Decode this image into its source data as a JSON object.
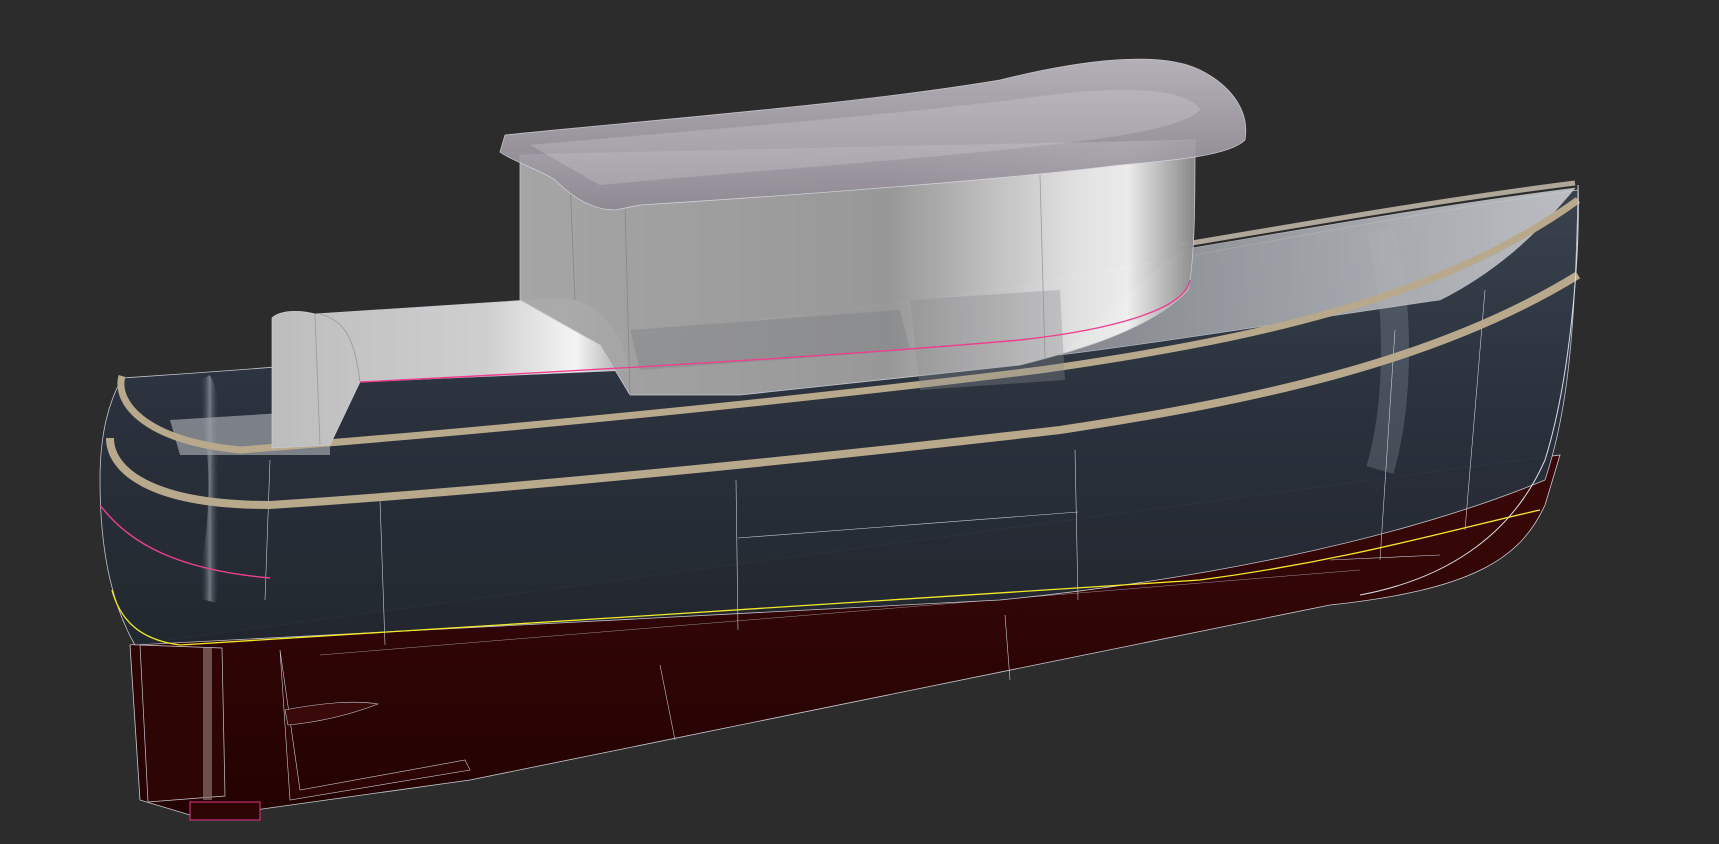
{
  "scene": {
    "subject": "tugboat-hull-3d-model",
    "background_color": "#2c2c2c",
    "colors": {
      "underbody": "#2a0404",
      "topsides": "#28303b",
      "superstructure": "#b5b5b5",
      "rub_rail": "#b9a98c",
      "wireframe": "#c9cbd3",
      "waterline": "#f2ea2a",
      "sheer_accent": "#ee3f8e"
    }
  }
}
